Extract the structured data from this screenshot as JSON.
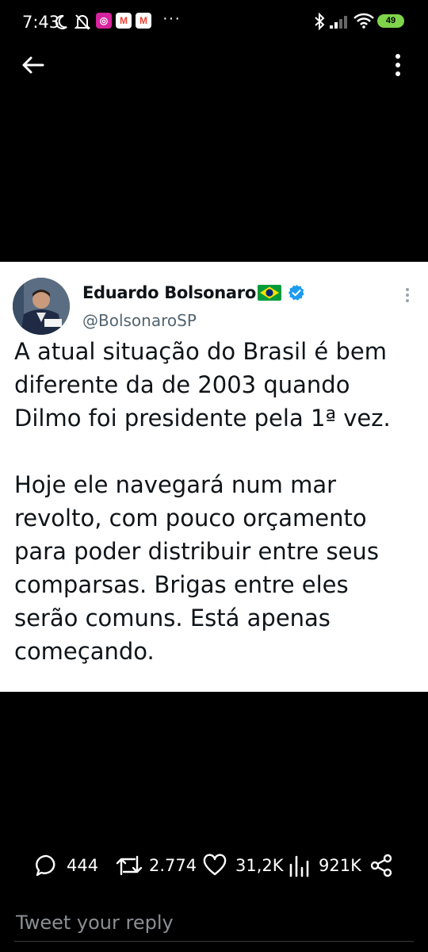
{
  "status_bar": {
    "time": "7:43",
    "more": "···",
    "battery": "49",
    "apps": [
      {
        "name": "instagram",
        "color": "#d6249f",
        "glyph": "◎"
      },
      {
        "name": "gmail",
        "color": "#ea4335",
        "glyph": "M"
      },
      {
        "name": "gmail",
        "color": "#ea4335",
        "glyph": "M"
      }
    ]
  },
  "tweet": {
    "display_name": "Eduardo Bolsonaro",
    "handle": "@BolsonaroSP",
    "text": "A atual situação do Brasil é bem diferente da de 2003 quando Dilmo foi presidente pela 1ª vez.\n\nHoje ele navegará num mar revolto, com pouco orçamento para poder distribuir entre seus comparsas. Brigas entre eles serão comuns. Está apenas começando."
  },
  "actions": {
    "replies": "444",
    "retweets": "2.774",
    "likes": "31,2K",
    "views": "921K"
  },
  "reply": {
    "placeholder": "Tweet your reply"
  },
  "colors": {
    "verified": "#1d9bf0",
    "card_bg": "#ffffff",
    "page_bg": "#000000"
  }
}
